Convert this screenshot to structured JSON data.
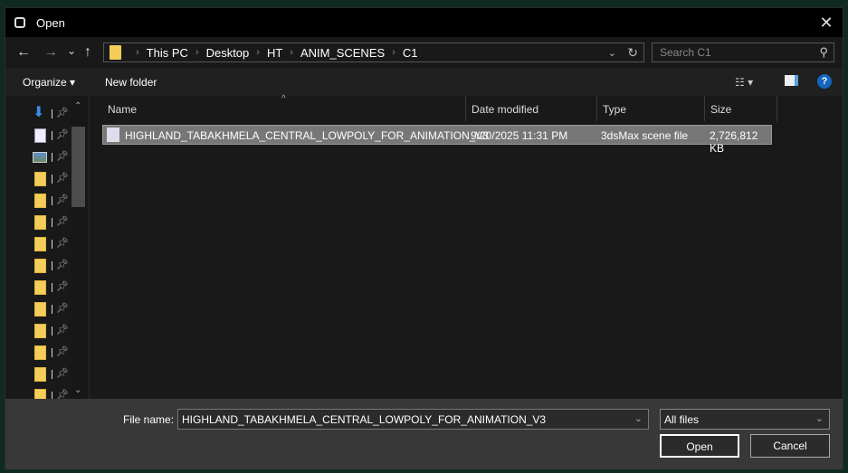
{
  "window": {
    "title": "Open",
    "close": "✕"
  },
  "nav": {
    "back": "←",
    "forward": "→",
    "recent": "⌄",
    "up": "↑",
    "path": [
      "This PC",
      "Desktop",
      "HT",
      "ANIM_SCENES",
      "C1"
    ],
    "search_placeholder": "Search C1"
  },
  "toolbar": {
    "organize": "Organize ▾",
    "new_folder": "New folder",
    "help": "?"
  },
  "sidebar": {
    "items": [
      "downloads",
      "documents",
      "pictures",
      "folder",
      "folder",
      "folder",
      "folder",
      "folder",
      "folder",
      "folder",
      "folder",
      "folder",
      "folder",
      "folder"
    ]
  },
  "columns": [
    "Name",
    "Date modified",
    "Type",
    "Size"
  ],
  "files": [
    {
      "name": "HIGHLAND_TABAKHMELA_CENTRAL_LOWPOLY_FOR_ANIMATION_V3",
      "date": "9/20/2025 11:31 PM",
      "type": "3dsMax scene file",
      "size": "2,726,812 KB"
    }
  ],
  "bottom": {
    "file_name_label": "File name:",
    "file_name_value": "HIGHLAND_TABAKHMELA_CENTRAL_LOWPOLY_FOR_ANIMATION_V3",
    "filter": "All files",
    "open": "Open",
    "cancel": "Cancel"
  }
}
